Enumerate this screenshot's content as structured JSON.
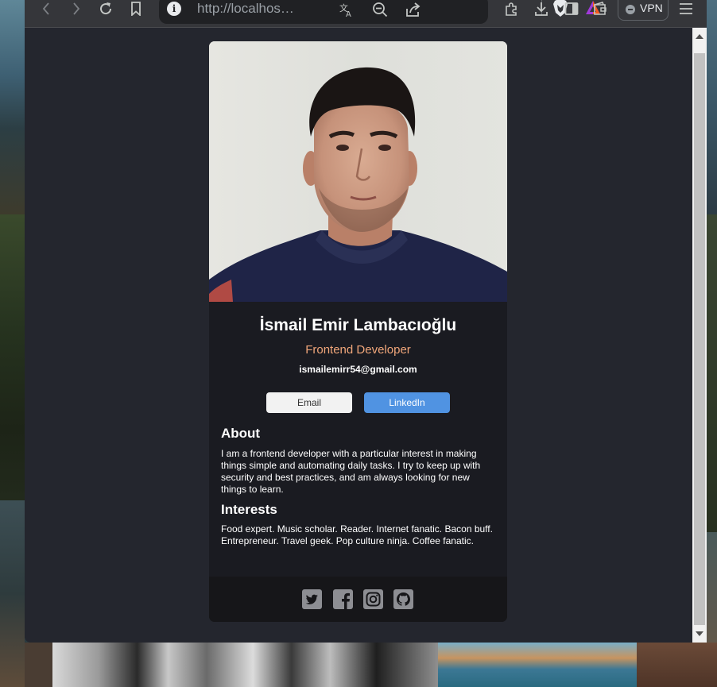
{
  "browser": {
    "url_display": "http://localhos…",
    "vpn_label": "VPN",
    "icons": [
      "back-icon",
      "forward-icon",
      "reload-icon",
      "bookmark-icon",
      "info-icon",
      "translate-icon",
      "zoom-out-icon",
      "share-icon",
      "brave-shields-icon",
      "brave-rewards-icon",
      "extensions-icon",
      "download-icon",
      "sidebar-icon",
      "wallet-icon",
      "vpn-icon",
      "menu-icon"
    ]
  },
  "profile": {
    "name": "İsmail Emir Lambacıoğlu",
    "role": "Frontend Developer",
    "email": "ismailemirr54@gmail.com",
    "buttons": {
      "email_label": "Email",
      "linkedin_label": "LinkedIn"
    },
    "about": {
      "heading": "About",
      "text": "I am a frontend developer with a particular interest in making things simple and automating daily tasks. I try to keep up with security and best practices, and am always looking for new things to learn."
    },
    "interests": {
      "heading": "Interests",
      "text": "Food expert. Music scholar. Reader. Internet fanatic. Bacon buff. Entrepreneur. Travel geek. Pop culture ninja. Coffee fanatic."
    },
    "social_icons": [
      "twitter-icon",
      "facebook-icon",
      "instagram-icon",
      "github-icon"
    ]
  },
  "colors": {
    "page_bg": "#24262e",
    "card_bg": "#1a1b21",
    "footer_bg": "#161619",
    "accent_title": "#f0a67a",
    "linkedin_button": "#5093e2",
    "email_button": "#f2f2f2",
    "social_icon": "#8d8e93"
  }
}
